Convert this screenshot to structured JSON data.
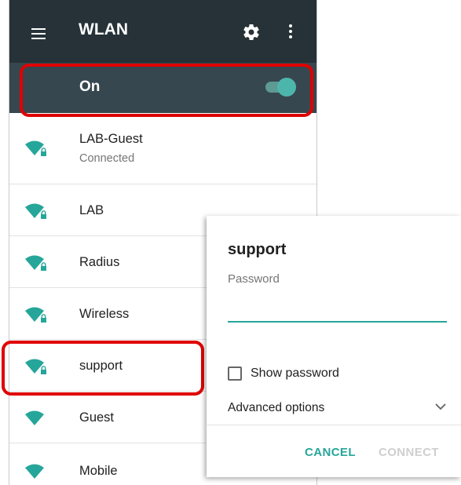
{
  "appbar": {
    "title": "WLAN",
    "menu_icon": "hamburger-icon",
    "settings_icon": "gear-icon",
    "overflow_icon": "more-vert-icon",
    "bg": "#263238"
  },
  "toggle": {
    "label": "On",
    "state": "on",
    "accent": "#4db6ac"
  },
  "networks": [
    {
      "ssid": "LAB-Guest",
      "status": "Connected",
      "secured": true
    },
    {
      "ssid": "LAB",
      "status": "",
      "secured": true
    },
    {
      "ssid": "Radius",
      "status": "",
      "secured": true
    },
    {
      "ssid": "Wireless",
      "status": "",
      "secured": true
    },
    {
      "ssid": "support",
      "status": "",
      "secured": true
    },
    {
      "ssid": "Guest",
      "status": "",
      "secured": false
    },
    {
      "ssid": "Mobile",
      "status": "",
      "secured": false
    }
  ],
  "dialog": {
    "title": "support",
    "password_label": "Password",
    "password_value": "",
    "show_password_label": "Show password",
    "show_password_checked": false,
    "advanced_label": "Advanced options",
    "cancel_label": "CANCEL",
    "connect_label": "CONNECT",
    "accent": "#26a69a"
  },
  "highlight_color": "#e00000"
}
